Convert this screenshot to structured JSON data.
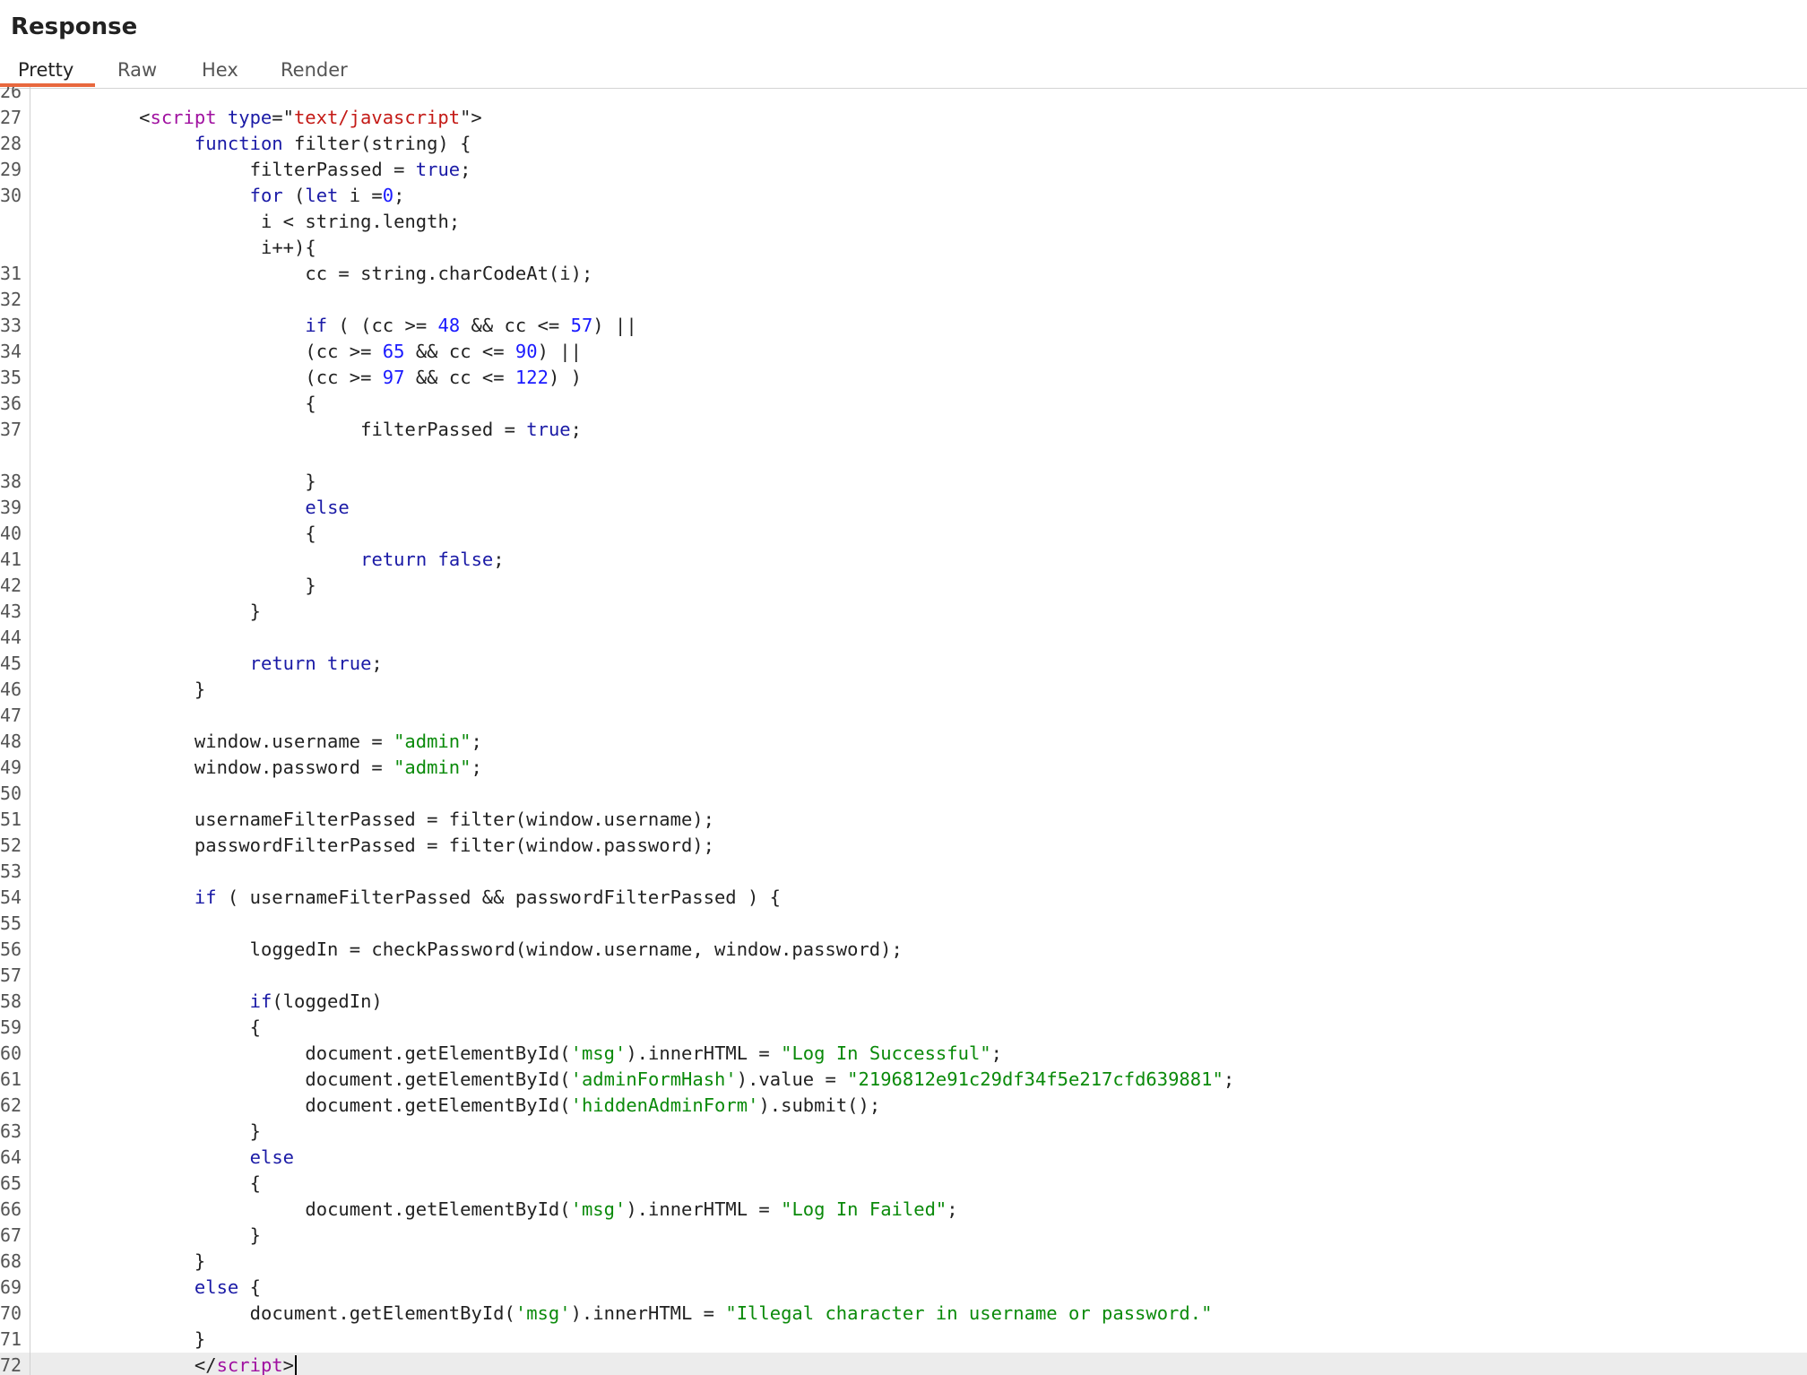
{
  "panel": {
    "title": "Response"
  },
  "tabs": [
    {
      "label": "Pretty",
      "active": true
    },
    {
      "label": "Raw",
      "active": false
    },
    {
      "label": "Hex",
      "active": false
    },
    {
      "label": "Render",
      "active": false
    }
  ],
  "colors": {
    "accent": "#e8683e",
    "keyword": "#1a1aa6",
    "string": "#0a8a0a",
    "number": "#1a1aff",
    "tag": "#a010a0",
    "attr_value": "#c41a16"
  },
  "lines": [
    {
      "n": "26",
      "indent": 0,
      "tokens": []
    },
    {
      "n": "27",
      "indent": 9,
      "tokens": [
        [
          "p",
          "<"
        ],
        [
          "tg",
          "script"
        ],
        [
          "p",
          " "
        ],
        [
          "at",
          "type"
        ],
        [
          "p",
          "=\""
        ],
        [
          "av",
          "text/javascript"
        ],
        [
          "p",
          "\">"
        ]
      ]
    },
    {
      "n": "28",
      "indent": 14,
      "tokens": [
        [
          "k",
          "function"
        ],
        [
          "p",
          " filter(string) {"
        ]
      ]
    },
    {
      "n": "29",
      "indent": 19,
      "tokens": [
        [
          "p",
          "filterPassed = "
        ],
        [
          "k",
          "true"
        ],
        [
          "p",
          ";"
        ]
      ]
    },
    {
      "n": "30",
      "indent": 19,
      "tokens": [
        [
          "k",
          "for"
        ],
        [
          "p",
          " ("
        ],
        [
          "k",
          "let"
        ],
        [
          "p",
          " i ="
        ],
        [
          "n",
          "0"
        ],
        [
          "p",
          ";"
        ]
      ]
    },
    {
      "n": "",
      "indent": 20,
      "tokens": [
        [
          "p",
          "i < string.length;"
        ]
      ]
    },
    {
      "n": "",
      "indent": 20,
      "tokens": [
        [
          "p",
          "i++){"
        ]
      ]
    },
    {
      "n": "31",
      "indent": 24,
      "tokens": [
        [
          "p",
          "cc = string.charCodeAt(i);"
        ]
      ]
    },
    {
      "n": "32",
      "indent": 0,
      "tokens": []
    },
    {
      "n": "33",
      "indent": 24,
      "tokens": [
        [
          "k",
          "if"
        ],
        [
          "p",
          " ( (cc >= "
        ],
        [
          "n",
          "48"
        ],
        [
          "p",
          " && cc <= "
        ],
        [
          "n",
          "57"
        ],
        [
          "p",
          ") ||"
        ]
      ]
    },
    {
      "n": "34",
      "indent": 24,
      "tokens": [
        [
          "p",
          "(cc >= "
        ],
        [
          "n",
          "65"
        ],
        [
          "p",
          " && cc <= "
        ],
        [
          "n",
          "90"
        ],
        [
          "p",
          ") ||"
        ]
      ]
    },
    {
      "n": "35",
      "indent": 24,
      "tokens": [
        [
          "p",
          "(cc >= "
        ],
        [
          "n",
          "97"
        ],
        [
          "p",
          " && cc <= "
        ],
        [
          "n",
          "122"
        ],
        [
          "p",
          ") )"
        ]
      ]
    },
    {
      "n": "36",
      "indent": 24,
      "tokens": [
        [
          "p",
          "{"
        ]
      ]
    },
    {
      "n": "37",
      "indent": 29,
      "tokens": [
        [
          "p",
          "filterPassed = "
        ],
        [
          "k",
          "true"
        ],
        [
          "p",
          ";"
        ]
      ]
    },
    {
      "n": "",
      "indent": 0,
      "tokens": []
    },
    {
      "n": "38",
      "indent": 24,
      "tokens": [
        [
          "p",
          "}"
        ]
      ]
    },
    {
      "n": "39",
      "indent": 24,
      "tokens": [
        [
          "k",
          "else"
        ]
      ]
    },
    {
      "n": "40",
      "indent": 24,
      "tokens": [
        [
          "p",
          "{"
        ]
      ]
    },
    {
      "n": "41",
      "indent": 29,
      "tokens": [
        [
          "k",
          "return"
        ],
        [
          "p",
          " "
        ],
        [
          "k",
          "false"
        ],
        [
          "p",
          ";"
        ]
      ]
    },
    {
      "n": "42",
      "indent": 24,
      "tokens": [
        [
          "p",
          "}"
        ]
      ]
    },
    {
      "n": "43",
      "indent": 19,
      "tokens": [
        [
          "p",
          "}"
        ]
      ]
    },
    {
      "n": "44",
      "indent": 0,
      "tokens": []
    },
    {
      "n": "45",
      "indent": 19,
      "tokens": [
        [
          "k",
          "return"
        ],
        [
          "p",
          " "
        ],
        [
          "k",
          "true"
        ],
        [
          "p",
          ";"
        ]
      ]
    },
    {
      "n": "46",
      "indent": 14,
      "tokens": [
        [
          "p",
          "}"
        ]
      ]
    },
    {
      "n": "47",
      "indent": 0,
      "tokens": []
    },
    {
      "n": "48",
      "indent": 14,
      "tokens": [
        [
          "p",
          "window.username = "
        ],
        [
          "s",
          "\"admin\""
        ],
        [
          "p",
          ";"
        ]
      ]
    },
    {
      "n": "49",
      "indent": 14,
      "tokens": [
        [
          "p",
          "window.password = "
        ],
        [
          "s",
          "\"admin\""
        ],
        [
          "p",
          ";"
        ]
      ]
    },
    {
      "n": "50",
      "indent": 0,
      "tokens": []
    },
    {
      "n": "51",
      "indent": 14,
      "tokens": [
        [
          "p",
          "usernameFilterPassed = filter(window.username);"
        ]
      ]
    },
    {
      "n": "52",
      "indent": 14,
      "tokens": [
        [
          "p",
          "passwordFilterPassed = filter(window.password);"
        ]
      ]
    },
    {
      "n": "53",
      "indent": 0,
      "tokens": []
    },
    {
      "n": "54",
      "indent": 14,
      "tokens": [
        [
          "k",
          "if"
        ],
        [
          "p",
          " ( usernameFilterPassed && passwordFilterPassed ) {"
        ]
      ]
    },
    {
      "n": "55",
      "indent": 0,
      "tokens": []
    },
    {
      "n": "56",
      "indent": 19,
      "tokens": [
        [
          "p",
          "loggedIn = checkPassword(window.username, window.password);"
        ]
      ]
    },
    {
      "n": "57",
      "indent": 0,
      "tokens": []
    },
    {
      "n": "58",
      "indent": 19,
      "tokens": [
        [
          "k",
          "if"
        ],
        [
          "p",
          "(loggedIn)"
        ]
      ]
    },
    {
      "n": "59",
      "indent": 19,
      "tokens": [
        [
          "p",
          "{"
        ]
      ]
    },
    {
      "n": "60",
      "indent": 24,
      "tokens": [
        [
          "p",
          "document.getElementById("
        ],
        [
          "s",
          "'msg'"
        ],
        [
          "p",
          ").innerHTML = "
        ],
        [
          "s",
          "\"Log In Successful\""
        ],
        [
          "p",
          ";"
        ]
      ]
    },
    {
      "n": "61",
      "indent": 24,
      "tokens": [
        [
          "p",
          "document.getElementById("
        ],
        [
          "s",
          "'adminFormHash'"
        ],
        [
          "p",
          ").value = "
        ],
        [
          "s",
          "\"2196812e91c29df34f5e217cfd639881\""
        ],
        [
          "p",
          ";"
        ]
      ]
    },
    {
      "n": "62",
      "indent": 24,
      "tokens": [
        [
          "p",
          "document.getElementById("
        ],
        [
          "s",
          "'hiddenAdminForm'"
        ],
        [
          "p",
          ").submit();"
        ]
      ]
    },
    {
      "n": "63",
      "indent": 19,
      "tokens": [
        [
          "p",
          "}"
        ]
      ]
    },
    {
      "n": "64",
      "indent": 19,
      "tokens": [
        [
          "k",
          "else"
        ]
      ]
    },
    {
      "n": "65",
      "indent": 19,
      "tokens": [
        [
          "p",
          "{"
        ]
      ]
    },
    {
      "n": "66",
      "indent": 24,
      "tokens": [
        [
          "p",
          "document.getElementById("
        ],
        [
          "s",
          "'msg'"
        ],
        [
          "p",
          ").innerHTML = "
        ],
        [
          "s",
          "\"Log In Failed\""
        ],
        [
          "p",
          ";"
        ]
      ]
    },
    {
      "n": "67",
      "indent": 19,
      "tokens": [
        [
          "p",
          "}"
        ]
      ]
    },
    {
      "n": "68",
      "indent": 14,
      "tokens": [
        [
          "p",
          "}"
        ]
      ]
    },
    {
      "n": "69",
      "indent": 14,
      "tokens": [
        [
          "k",
          "else"
        ],
        [
          "p",
          " {"
        ]
      ]
    },
    {
      "n": "70",
      "indent": 19,
      "tokens": [
        [
          "p",
          "document.getElementById("
        ],
        [
          "s",
          "'msg'"
        ],
        [
          "p",
          ").innerHTML = "
        ],
        [
          "s",
          "\"Illegal character in username or password.\""
        ]
      ]
    },
    {
      "n": "71",
      "indent": 14,
      "tokens": [
        [
          "p",
          "}"
        ]
      ]
    },
    {
      "n": "72",
      "indent": 14,
      "tokens": [
        [
          "p",
          "</"
        ],
        [
          "tg",
          "script"
        ],
        [
          "p",
          ">"
        ]
      ],
      "current": true
    }
  ]
}
